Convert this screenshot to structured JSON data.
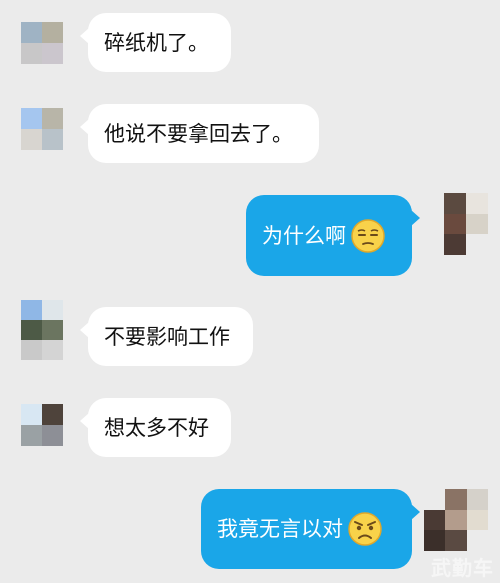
{
  "messages": [
    {
      "side": "in",
      "text": "碎纸机了。"
    },
    {
      "side": "in",
      "text": "他说不要拿回去了。"
    },
    {
      "side": "out",
      "text": "为什么啊",
      "emoji": "unamused-face-icon"
    },
    {
      "side": "in",
      "text": "不要影响工作"
    },
    {
      "side": "in",
      "text": "想太多不好"
    },
    {
      "side": "out",
      "text": "我竟无言以对",
      "emoji": "angry-face-icon"
    }
  ],
  "avatars": {
    "a1": [
      "#9fb3c4",
      "#b4b0a0",
      "#c8c7c8",
      "#cbc6cd"
    ],
    "a2": [
      "#a5c6ef",
      "#b8b5a8",
      "#d8d5d0",
      "#b8c2c9"
    ],
    "a3": [
      "#5b4a40",
      "#e8e4de",
      "#6a4a3e",
      "#8a7568"
    ],
    "a4": [
      "#8fb7e6",
      "#dfe6ea",
      "#4d5a46",
      "#6b7560"
    ],
    "a5": [
      "#d8e7f3",
      "#4e433b",
      "#9aa1a4",
      "#8d8f96"
    ],
    "a6": [
      "#8a7365",
      "#d5d1ca",
      "#4a3a34",
      "#e2dcd0"
    ]
  },
  "watermark": "武勤车",
  "colors": {
    "incoming_bubble": "#ffffff",
    "outgoing_bubble": "#1aa6e8",
    "background": "#ebebeb"
  }
}
